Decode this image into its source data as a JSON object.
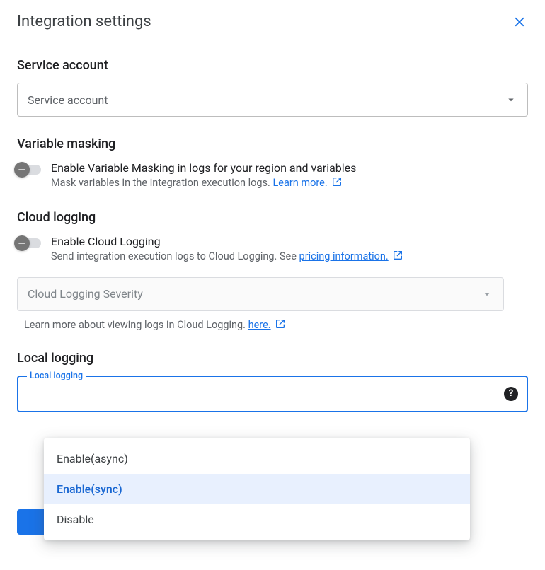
{
  "header": {
    "title": "Integration settings"
  },
  "service_account": {
    "heading": "Service account",
    "placeholder": "Service account"
  },
  "variable_masking": {
    "heading": "Variable masking",
    "label": "Enable Variable Masking in logs for your region and variables",
    "desc_pre": "Mask variables in the integration execution logs. ",
    "link": "Learn more."
  },
  "cloud_logging": {
    "heading": "Cloud logging",
    "label": "Enable Cloud Logging",
    "desc_pre": "Send integration execution logs to Cloud Logging. See ",
    "link": "pricing information.",
    "severity_placeholder": "Cloud Logging Severity",
    "note_pre": "Learn more about viewing logs in Cloud Logging. ",
    "note_link": "here."
  },
  "local_logging": {
    "heading": "Local logging",
    "field_label": "Local logging",
    "options": [
      "Enable(async)",
      "Enable(sync)",
      "Disable"
    ],
    "selected": "Enable(sync)"
  }
}
